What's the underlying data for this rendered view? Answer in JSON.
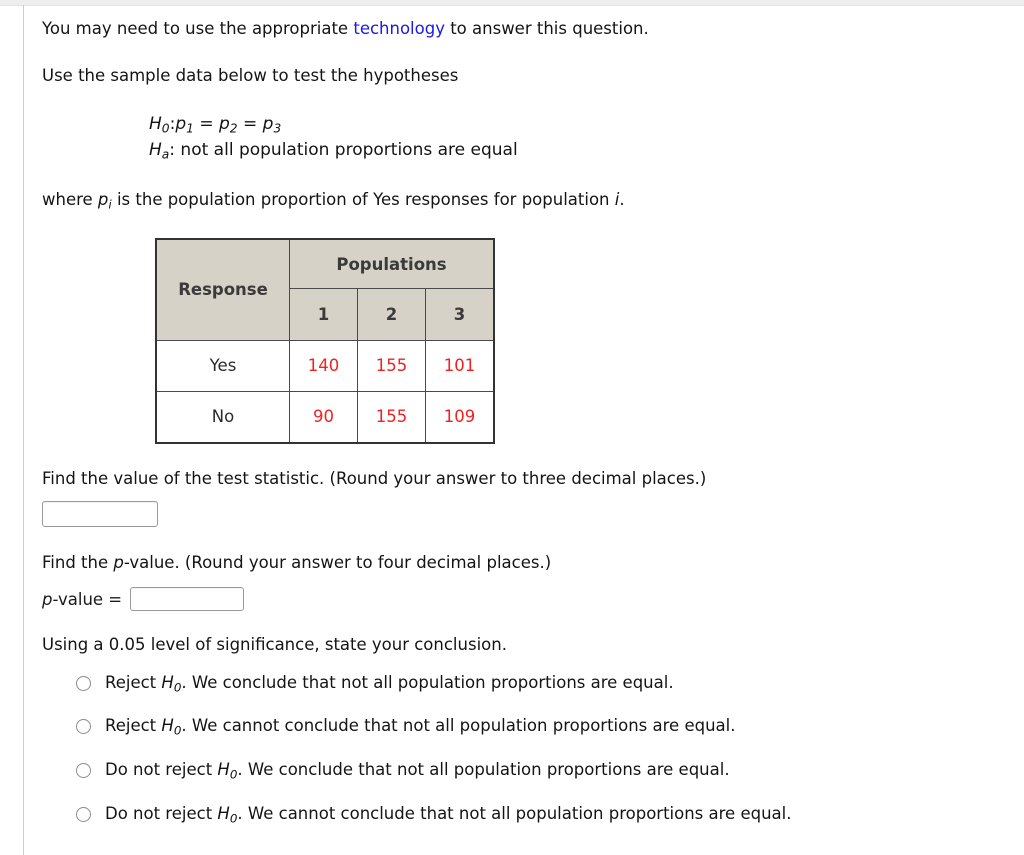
{
  "intro": {
    "before_link": "You may need to use the appropriate ",
    "link_text": "technology",
    "after_link": " to answer this question.",
    "link_color": "#1a1ae6"
  },
  "instruction": "Use the sample data below to test the hypotheses",
  "hypotheses": {
    "null_symbol": "H",
    "null_sub": "0",
    "null_body": ": p",
    "null_line_plain": "H0: p1 = p2 = p3",
    "alt_symbol": "H",
    "alt_sub": "a",
    "alt_text": ": not all population proportions are equal",
    "p_symbol": "p",
    "sub_1": "1",
    "sub_2": "2",
    "sub_3": "3",
    "eq": "=",
    "colon": ":"
  },
  "where_clause": {
    "prefix": "where ",
    "p": "p",
    "sub_i": "i",
    "middle": " is the population proportion of Yes responses for population ",
    "italic_i": "i",
    "suffix": "."
  },
  "table": {
    "row_header_label": "Response",
    "group_header": "Populations",
    "columns": [
      "1",
      "2",
      "3"
    ],
    "rows": [
      {
        "label": "Yes",
        "values": [
          "140",
          "155",
          "101"
        ]
      },
      {
        "label": "No",
        "values": [
          "90",
          "155",
          "109"
        ]
      }
    ],
    "header_bg": "#d6d2c8",
    "value_color": "#ee2222"
  },
  "test_statistic": {
    "prompt": "Find the value of the test statistic. (Round your answer to three decimal places.)",
    "value": "",
    "placeholder": ""
  },
  "p_value": {
    "prompt_before_italic": "Find the ",
    "prompt_italic": "p",
    "prompt_after_italic": "-value. (Round your answer to four decimal places.)",
    "label_italic": "p",
    "label_rest": "-value =",
    "value": "",
    "placeholder": ""
  },
  "conclusion": {
    "prompt": "Using a 0.05 level of significance, state your conclusion.",
    "options": [
      {
        "lead": "Reject ",
        "symbol": "H",
        "sub": "0",
        "rest": ". We conclude that not all population proportions are equal.",
        "selected": false
      },
      {
        "lead": "Reject ",
        "symbol": "H",
        "sub": "0",
        "rest": ". We cannot conclude that not all population proportions are equal.",
        "selected": false
      },
      {
        "lead": "Do not reject ",
        "symbol": "H",
        "sub": "0",
        "rest": ". We conclude that not all population proportions are equal.",
        "selected": false
      },
      {
        "lead": "Do not reject ",
        "symbol": "H",
        "sub": "0",
        "rest": ". We cannot conclude that not all population proportions are equal.",
        "selected": false
      }
    ]
  }
}
